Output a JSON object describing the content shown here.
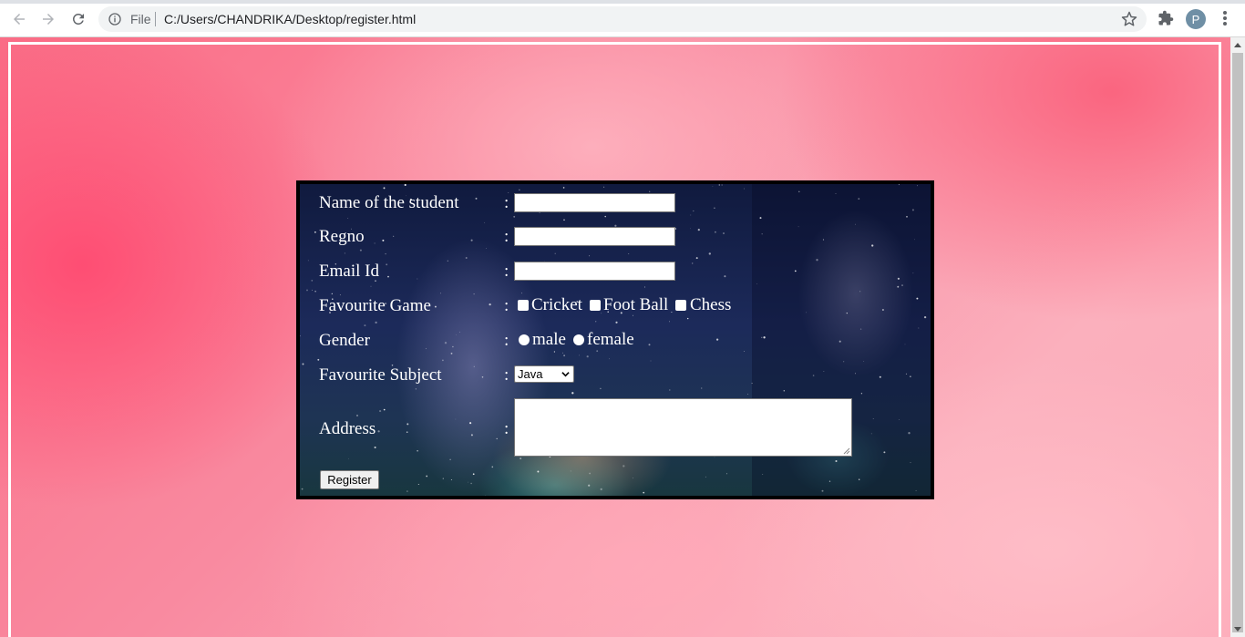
{
  "browser": {
    "file_label": "File",
    "url": "C:/Users/CHANDRIKA/Desktop/register.html",
    "avatar_letter": "P"
  },
  "form": {
    "name_label": "Name of the student",
    "regno_label": "Regno",
    "email_label": "Email Id",
    "game_label": "Favourite Game",
    "games": [
      "Cricket",
      "Foot Ball",
      "Chess"
    ],
    "gender_label": "Gender",
    "genders": [
      "male",
      "female"
    ],
    "subject_label": "Favourite Subject",
    "subject_selected": "Java",
    "address_label": "Address",
    "colon": ":",
    "register_button": "Register"
  },
  "colors": {
    "page_background": "#f98aa0",
    "form_background": "#1c2a5a",
    "form_text": "#ffffff"
  }
}
